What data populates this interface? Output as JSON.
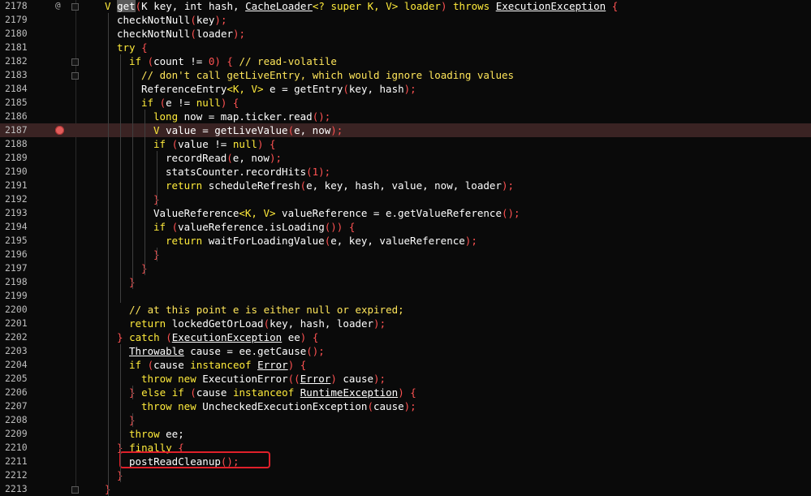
{
  "editor": {
    "annotation_symbol": "@",
    "lines": [
      {
        "n": "2178",
        "indent": 0,
        "tokens": [
          {
            "t": "V ",
            "c": "kw"
          },
          {
            "t": "get",
            "c": "sel"
          },
          {
            "t": "(",
            "c": "br"
          },
          {
            "t": "K key, int hash, "
          },
          {
            "t": "CacheLoader",
            "c": "ul"
          },
          {
            "t": "<? super K, V> loader",
            "c": "kw"
          },
          {
            "t": ") ",
            "c": "br"
          },
          {
            "t": "throws ",
            "c": "kw"
          },
          {
            "t": "ExecutionException",
            "c": "ul"
          },
          {
            "t": " {",
            "c": "br"
          }
        ]
      },
      {
        "n": "2179",
        "indent": 1,
        "tokens": [
          {
            "t": "checkNotNull"
          },
          {
            "t": "(",
            "c": "br"
          },
          {
            "t": "key"
          },
          {
            "t": ");",
            "c": "br"
          }
        ]
      },
      {
        "n": "2180",
        "indent": 1,
        "tokens": [
          {
            "t": "checkNotNull"
          },
          {
            "t": "(",
            "c": "br"
          },
          {
            "t": "loader"
          },
          {
            "t": ");",
            "c": "br"
          }
        ]
      },
      {
        "n": "2181",
        "indent": 1,
        "tokens": [
          {
            "t": "try ",
            "c": "kw"
          },
          {
            "t": "{",
            "c": "br"
          }
        ]
      },
      {
        "n": "2182",
        "indent": 2,
        "tokens": [
          {
            "t": "if ",
            "c": "kw"
          },
          {
            "t": "(",
            "c": "br"
          },
          {
            "t": "count != "
          },
          {
            "t": "0",
            "c": "num"
          },
          {
            "t": ") { ",
            "c": "br"
          },
          {
            "t": "// read-volatile",
            "c": "cm"
          }
        ]
      },
      {
        "n": "2183",
        "indent": 3,
        "tokens": [
          {
            "t": "// don't call getLiveEntry, which would ignore loading values",
            "c": "cm"
          }
        ]
      },
      {
        "n": "2184",
        "indent": 3,
        "tokens": [
          {
            "t": "ReferenceEntry"
          },
          {
            "t": "<K, V>",
            "c": "kw"
          },
          {
            "t": " e = getEntry"
          },
          {
            "t": "(",
            "c": "br"
          },
          {
            "t": "key, hash"
          },
          {
            "t": ");",
            "c": "br"
          }
        ]
      },
      {
        "n": "2185",
        "indent": 3,
        "tokens": [
          {
            "t": "if ",
            "c": "kw"
          },
          {
            "t": "(",
            "c": "br"
          },
          {
            "t": "e != "
          },
          {
            "t": "null",
            "c": "kw"
          },
          {
            "t": ") {",
            "c": "br"
          }
        ]
      },
      {
        "n": "2186",
        "indent": 4,
        "tokens": [
          {
            "t": "long ",
            "c": "kw"
          },
          {
            "t": "now = map.ticker.read"
          },
          {
            "t": "();",
            "c": "br"
          }
        ]
      },
      {
        "n": "2187",
        "indent": 4,
        "highlight": true,
        "breakpoint": true,
        "tokens": [
          {
            "t": "V ",
            "c": "kw"
          },
          {
            "t": "value = getLiveValue"
          },
          {
            "t": "(",
            "c": "br"
          },
          {
            "t": "e, now"
          },
          {
            "t": ");",
            "c": "br"
          }
        ]
      },
      {
        "n": "2188",
        "indent": 4,
        "tokens": [
          {
            "t": "if ",
            "c": "kw"
          },
          {
            "t": "(",
            "c": "br"
          },
          {
            "t": "value != "
          },
          {
            "t": "null",
            "c": "kw"
          },
          {
            "t": ") {",
            "c": "br"
          }
        ]
      },
      {
        "n": "2189",
        "indent": 5,
        "tokens": [
          {
            "t": "recordRead"
          },
          {
            "t": "(",
            "c": "br"
          },
          {
            "t": "e, now"
          },
          {
            "t": ");",
            "c": "br"
          }
        ]
      },
      {
        "n": "2190",
        "indent": 5,
        "tokens": [
          {
            "t": "statsCounter.recordHits"
          },
          {
            "t": "(",
            "c": "br"
          },
          {
            "t": "1",
            "c": "num"
          },
          {
            "t": ");",
            "c": "br"
          }
        ]
      },
      {
        "n": "2191",
        "indent": 5,
        "tokens": [
          {
            "t": "return ",
            "c": "kw"
          },
          {
            "t": "scheduleRefresh"
          },
          {
            "t": "(",
            "c": "br"
          },
          {
            "t": "e, key, hash, value, now, loader"
          },
          {
            "t": ");",
            "c": "br"
          }
        ]
      },
      {
        "n": "2192",
        "indent": 4,
        "tokens": [
          {
            "t": "}",
            "c": "br"
          }
        ]
      },
      {
        "n": "2193",
        "indent": 4,
        "tokens": [
          {
            "t": "ValueReference"
          },
          {
            "t": "<K, V>",
            "c": "kw"
          },
          {
            "t": " valueReference = e.getValueReference"
          },
          {
            "t": "();",
            "c": "br"
          }
        ]
      },
      {
        "n": "2194",
        "indent": 4,
        "tokens": [
          {
            "t": "if ",
            "c": "kw"
          },
          {
            "t": "(",
            "c": "br"
          },
          {
            "t": "valueReference.isLoading"
          },
          {
            "t": "()) {",
            "c": "br"
          }
        ]
      },
      {
        "n": "2195",
        "indent": 5,
        "tokens": [
          {
            "t": "return ",
            "c": "kw"
          },
          {
            "t": "waitForLoadingValue"
          },
          {
            "t": "(",
            "c": "br"
          },
          {
            "t": "e, key, valueReference"
          },
          {
            "t": ");",
            "c": "br"
          }
        ]
      },
      {
        "n": "2196",
        "indent": 4,
        "tokens": [
          {
            "t": "}",
            "c": "br"
          }
        ]
      },
      {
        "n": "2197",
        "indent": 3,
        "tokens": [
          {
            "t": "}",
            "c": "br"
          }
        ]
      },
      {
        "n": "2198",
        "indent": 2,
        "tokens": [
          {
            "t": "}",
            "c": "br"
          }
        ]
      },
      {
        "n": "2199",
        "indent": 0,
        "tokens": []
      },
      {
        "n": "2200",
        "indent": 2,
        "tokens": [
          {
            "t": "// at this point e is either null or expired;",
            "c": "cm"
          }
        ]
      },
      {
        "n": "2201",
        "indent": 2,
        "tokens": [
          {
            "t": "return ",
            "c": "kw"
          },
          {
            "t": "lockedGetOrLoad"
          },
          {
            "t": "(",
            "c": "br"
          },
          {
            "t": "key, hash, loader"
          },
          {
            "t": ");",
            "c": "br"
          }
        ]
      },
      {
        "n": "2202",
        "indent": 1,
        "tokens": [
          {
            "t": "} ",
            "c": "br"
          },
          {
            "t": "catch ",
            "c": "kw"
          },
          {
            "t": "(",
            "c": "br"
          },
          {
            "t": "ExecutionException",
            "c": "ul"
          },
          {
            "t": " ee"
          },
          {
            "t": ") {",
            "c": "br"
          }
        ]
      },
      {
        "n": "2203",
        "indent": 2,
        "tokens": [
          {
            "t": "Throwable",
            "c": "ul"
          },
          {
            "t": " cause = ee.getCause"
          },
          {
            "t": "();",
            "c": "br"
          }
        ]
      },
      {
        "n": "2204",
        "indent": 2,
        "tokens": [
          {
            "t": "if ",
            "c": "kw"
          },
          {
            "t": "(",
            "c": "br"
          },
          {
            "t": "cause "
          },
          {
            "t": "instanceof ",
            "c": "kw"
          },
          {
            "t": "Error",
            "c": "ul"
          },
          {
            "t": ") {",
            "c": "br"
          }
        ]
      },
      {
        "n": "2205",
        "indent": 3,
        "tokens": [
          {
            "t": "throw new ",
            "c": "kw"
          },
          {
            "t": "ExecutionError"
          },
          {
            "t": "((",
            "c": "br"
          },
          {
            "t": "Error",
            "c": "ul"
          },
          {
            "t": ") ",
            "c": "br"
          },
          {
            "t": "cause"
          },
          {
            "t": ");",
            "c": "br"
          }
        ]
      },
      {
        "n": "2206",
        "indent": 2,
        "tokens": [
          {
            "t": "} ",
            "c": "br"
          },
          {
            "t": "else if ",
            "c": "kw"
          },
          {
            "t": "(",
            "c": "br"
          },
          {
            "t": "cause "
          },
          {
            "t": "instanceof ",
            "c": "kw"
          },
          {
            "t": "RuntimeException",
            "c": "ul"
          },
          {
            "t": ") {",
            "c": "br"
          }
        ]
      },
      {
        "n": "2207",
        "indent": 3,
        "tokens": [
          {
            "t": "throw new ",
            "c": "kw"
          },
          {
            "t": "UncheckedExecutionException"
          },
          {
            "t": "(",
            "c": "br"
          },
          {
            "t": "cause"
          },
          {
            "t": ");",
            "c": "br"
          }
        ]
      },
      {
        "n": "2208",
        "indent": 2,
        "tokens": [
          {
            "t": "}",
            "c": "br"
          }
        ]
      },
      {
        "n": "2209",
        "indent": 2,
        "tokens": [
          {
            "t": "throw ",
            "c": "kw"
          },
          {
            "t": "ee;"
          }
        ]
      },
      {
        "n": "2210",
        "indent": 1,
        "tokens": [
          {
            "t": "} ",
            "c": "br"
          },
          {
            "t": "finally ",
            "c": "kw"
          },
          {
            "t": "{",
            "c": "br"
          }
        ]
      },
      {
        "n": "2211",
        "indent": 2,
        "boxed": true,
        "tokens": [
          {
            "t": "postReadCleanup"
          },
          {
            "t": "();",
            "c": "br"
          }
        ]
      },
      {
        "n": "2212",
        "indent": 1,
        "tokens": [
          {
            "t": "}",
            "c": "br"
          }
        ]
      },
      {
        "n": "2213",
        "indent": 0,
        "tokens": [
          {
            "t": "}",
            "c": "br"
          }
        ]
      }
    ]
  }
}
